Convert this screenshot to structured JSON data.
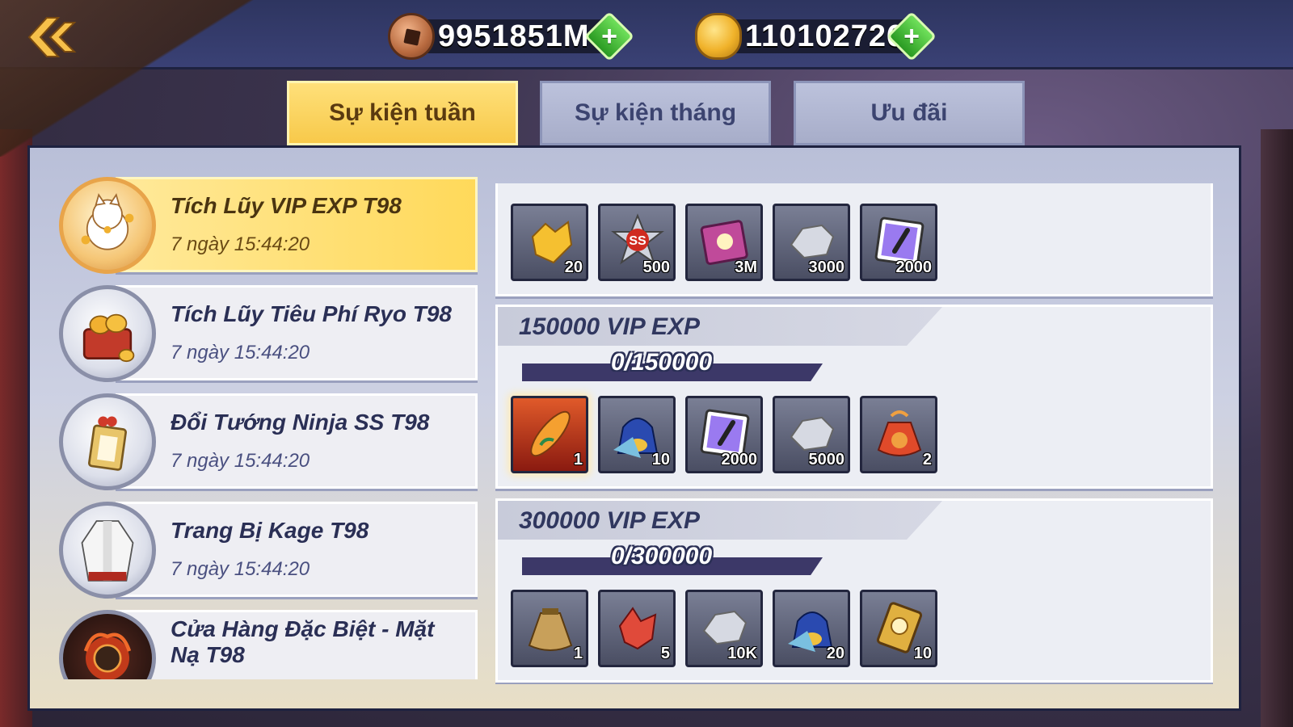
{
  "currencies": [
    {
      "icon": "ryo-coin-icon",
      "value": "9951851M"
    },
    {
      "icon": "gold-ingot-icon",
      "value": "110102726"
    }
  ],
  "tabs": [
    {
      "label": "Sự kiện tuần",
      "active": true
    },
    {
      "label": "Sự kiện tháng",
      "active": false
    },
    {
      "label": "Ưu đãi",
      "active": false
    }
  ],
  "events": [
    {
      "title": "Tích Lũy VIP EXP T98",
      "time": "7 ngày 15:44:20",
      "icon": "lucky-cat-icon",
      "active": true
    },
    {
      "title": "Tích Lũy Tiêu Phí Ryo T98",
      "time": "7 ngày 15:44:20",
      "icon": "gold-basket-icon",
      "active": false
    },
    {
      "title": "Đổi Tướng Ninja SS T98",
      "time": "7 ngày 15:44:20",
      "icon": "gift-box-icon",
      "active": false
    },
    {
      "title": "Trang Bị Kage T98",
      "time": "7 ngày 15:44:20",
      "icon": "kage-robe-icon",
      "active": false
    },
    {
      "title": "Cửa Hàng Đặc Biệt - Mặt Nạ T98",
      "time": "",
      "icon": "mask-icon",
      "active": false
    }
  ],
  "tiers": [
    {
      "label": "",
      "progress": "",
      "items": [
        {
          "icon": "gold-crystal-icon",
          "qty": "20"
        },
        {
          "icon": "ss-badge-icon",
          "qty": "500"
        },
        {
          "icon": "skill-book-icon",
          "qty": "3M"
        },
        {
          "icon": "silver-ore-icon",
          "qty": "3000"
        },
        {
          "icon": "purple-scroll-icon",
          "qty": "2000"
        }
      ]
    },
    {
      "label": "150000 VIP EXP",
      "progress": "0/150000",
      "items": [
        {
          "icon": "surfboard-icon",
          "qty": "1"
        },
        {
          "icon": "blue-bag-icon",
          "qty": "10"
        },
        {
          "icon": "purple-scroll-icon",
          "qty": "2000"
        },
        {
          "icon": "silver-ore-icon",
          "qty": "5000"
        },
        {
          "icon": "red-pouch-icon",
          "qty": "2"
        }
      ]
    },
    {
      "label": "300000 VIP EXP",
      "progress": "0/300000",
      "items": [
        {
          "icon": "sack-icon",
          "qty": "1"
        },
        {
          "icon": "red-crystal-icon",
          "qty": "5"
        },
        {
          "icon": "silver-ore-icon",
          "qty": "10K"
        },
        {
          "icon": "blue-bag-icon",
          "qty": "20"
        },
        {
          "icon": "gold-card-icon",
          "qty": "10"
        }
      ]
    }
  ],
  "colors": {
    "active_tab": "#f7c94a",
    "inactive_tab": "#a7adc9",
    "panel": "#cdd1e3",
    "plus": "#2a9a22"
  }
}
